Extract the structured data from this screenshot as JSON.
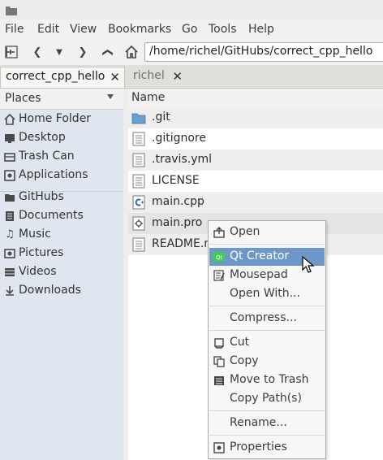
{
  "menubar": {
    "file": "File",
    "edit": "Edit",
    "view": "View",
    "bookmarks": "Bookmarks",
    "go": "Go",
    "tools": "Tools",
    "help": "Help"
  },
  "toolbar": {
    "path": "/home/richel/GitHubs/correct_cpp_hello"
  },
  "tabs": [
    {
      "label": "correct_cpp_hello"
    },
    {
      "label": "richel"
    }
  ],
  "sidebar": {
    "header": "Places",
    "devices": [
      {
        "label": "Home Folder",
        "icon": "home-icon"
      },
      {
        "label": "Desktop",
        "icon": "desktop-icon"
      },
      {
        "label": "Trash Can",
        "icon": "trash-icon"
      },
      {
        "label": "Applications",
        "icon": "applications-icon"
      }
    ],
    "bookmarks": [
      {
        "label": "GitHubs",
        "icon": "folder-icon"
      },
      {
        "label": "Documents",
        "icon": "documents-icon"
      },
      {
        "label": "Music",
        "icon": "music-icon"
      },
      {
        "label": "Pictures",
        "icon": "pictures-icon"
      },
      {
        "label": "Videos",
        "icon": "videos-icon"
      },
      {
        "label": "Downloads",
        "icon": "downloads-icon"
      }
    ]
  },
  "files": {
    "column": "Name",
    "rows": [
      {
        "name": ".git",
        "icon": "folder-icon"
      },
      {
        "name": ".gitignore",
        "icon": "text-file-icon"
      },
      {
        "name": ".travis.yml",
        "icon": "text-file-icon"
      },
      {
        "name": "LICENSE",
        "icon": "text-file-icon"
      },
      {
        "name": "main.cpp",
        "icon": "cpp-file-icon"
      },
      {
        "name": "main.pro",
        "icon": "project-file-icon"
      },
      {
        "name": "README.md",
        "icon": "text-file-icon"
      }
    ]
  },
  "context_menu": {
    "open": "Open",
    "qt_creator": "Qt Creator",
    "mousepad": "Mousepad",
    "open_with": "Open With...",
    "compress": "Compress...",
    "cut": "Cut",
    "copy": "Copy",
    "move_to_trash": "Move to Trash",
    "copy_paths": "Copy Path(s)",
    "rename": "Rename...",
    "properties": "Properties"
  },
  "colors": {
    "highlight": "#6d97c9",
    "sidebar": "#dfe6ef",
    "folder": "#6a9fd4"
  }
}
